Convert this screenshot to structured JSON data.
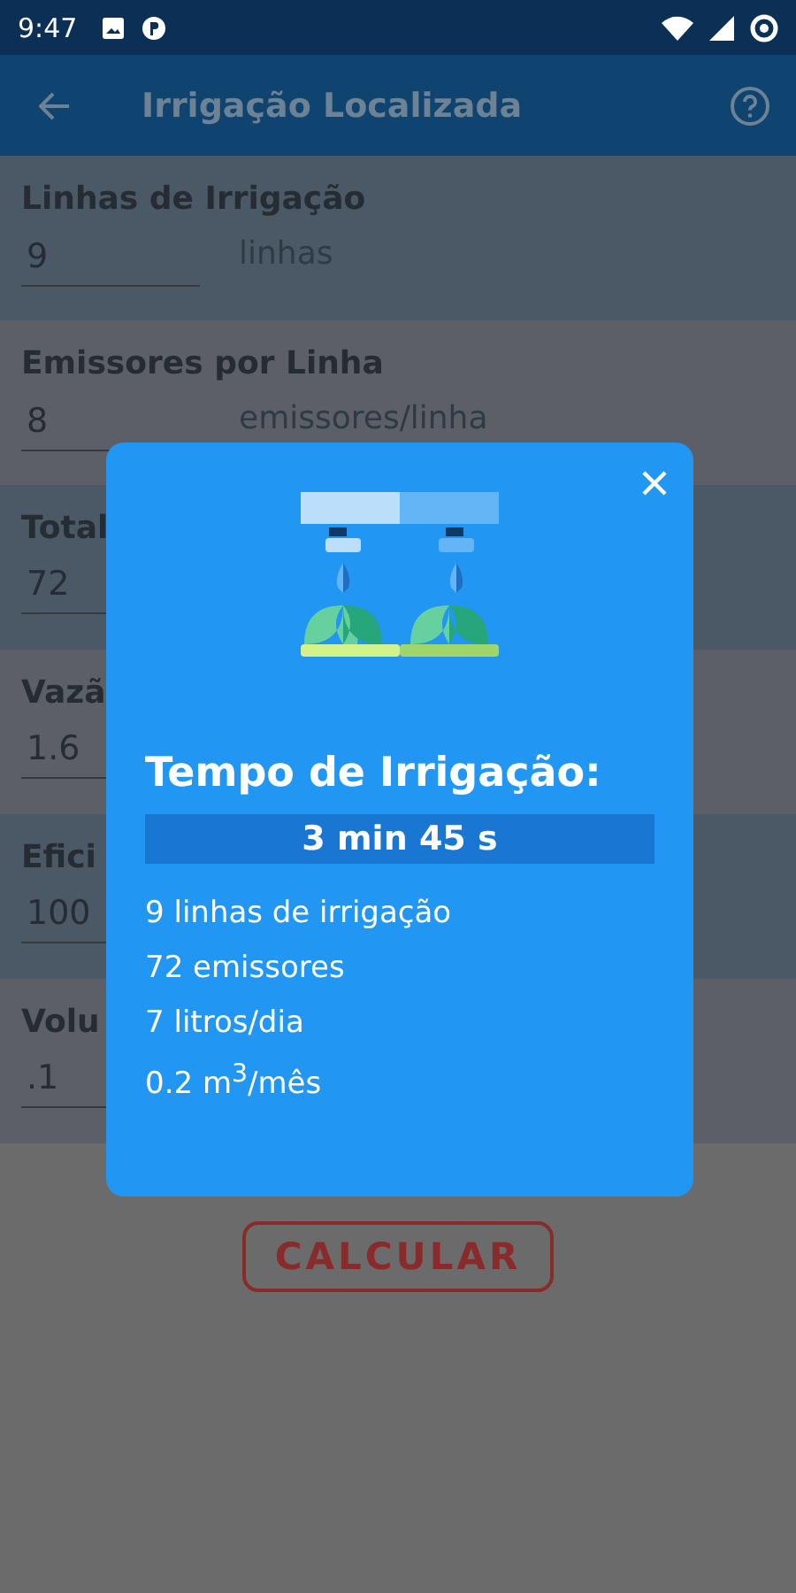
{
  "status_bar": {
    "time": "9:47"
  },
  "app_bar": {
    "title": "Irrigação Localizada"
  },
  "fields": [
    {
      "label": "Linhas de Irrigação",
      "value": "9",
      "unit": "linhas"
    },
    {
      "label": "Emissores por Linha",
      "value": "8",
      "unit": "emissores/linha"
    },
    {
      "label": "Total",
      "value": "72"
    },
    {
      "label": "Vazã",
      "value": "1.6"
    },
    {
      "label": "Efici",
      "value": "100"
    },
    {
      "label": "Volu",
      "value": ".1"
    }
  ],
  "calculate_button": {
    "label": "CALCULAR"
  },
  "dialog": {
    "title": "Tempo de Irrigação:",
    "result": "3 min  45 s",
    "lines": [
      "9  linhas de irrigação",
      "72  emissores",
      "7  litros/dia",
      "0.2  m$^{3}$/mês"
    ]
  }
}
